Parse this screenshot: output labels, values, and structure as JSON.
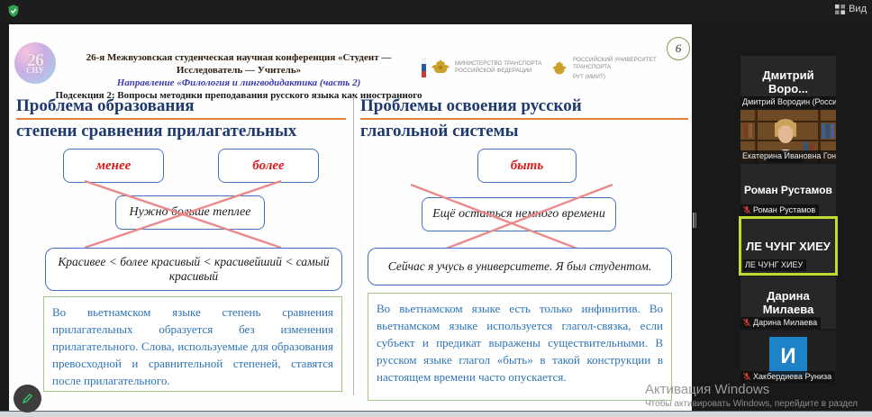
{
  "topbar": {
    "view_label": "Вид"
  },
  "slide": {
    "page_number": "6",
    "siu_logo": {
      "number": "26",
      "acronym": "СИУ"
    },
    "header": {
      "line1": "26-я Межвузовская студенческая научная конференция «Студент — Исследователь — Учитель»",
      "line2": "Направление «Филология и лингводидактика (часть 2)",
      "line3": "Подсекция 2: Вопросы методики преподавания русского языка как иностранного"
    },
    "ministry": {
      "line1": "МИНИСТЕРСТВО ТРАНСПОРТА",
      "line2": "РОССИЙСКОЙ ФЕДЕРАЦИИ"
    },
    "university": {
      "line1": "РОССИЙСКИЙ УНИВЕРСИТЕТ",
      "line2": "ТРАНСПОРТА",
      "line3": "РУТ (МИИТ)"
    },
    "left": {
      "title_line1": "Проблема образования",
      "title_line2": "степени сравнения прилагательных",
      "chip_less": "менее",
      "chip_more": "более",
      "crossed_example": "Нужно больше теплее",
      "comparison_example": "Красивее < более красивый < красивейший < самый красивый",
      "note": "Во вьетнамском языке степень сравнения прилагательных образуется без изменения прилагательного. Слова, используемые для образования превосходной и сравнительной степеней, ставятся после прилагательного."
    },
    "right": {
      "title_line1": "Проблемы освоения  русской",
      "title_line2": "глагольной системы",
      "chip_byt": "быть",
      "crossed_example": "Ещё остаться немного времени",
      "correct_example": "Сейчас я учусь в университете. Я был студентом.",
      "note": "Во вьетнамском языке есть только инфинитив. Во вьетнамском языке используется глагол-связка, если субъект и предикат выражены существительными. В русском языке глагол «быть» в такой конструкции в настоящем времени часто опускается."
    }
  },
  "participants": [
    {
      "name_display": "Дмитрий Воро...",
      "label": "Дмитрий Вородин (Росси...",
      "muted": false
    },
    {
      "name_display": "",
      "label": "Екатерина Ивановна Гон...",
      "muted": false
    },
    {
      "name_display": "Роман Рустамов",
      "label": "Роман Рустамов",
      "muted": true
    },
    {
      "name_display": "ЛЕ ЧУНГ ХИЕУ",
      "label": "ЛЕ ЧУНГ ХИЕУ",
      "muted": false,
      "active_speaker": true
    },
    {
      "name_display": "Дарина Милаева",
      "label": "Дарина Милаева",
      "muted": true
    },
    {
      "avatar_letter": "И",
      "label": "Хакбердиева Руниза",
      "muted": true
    }
  ],
  "watermark": {
    "line1": "Активация Windows",
    "line2": "Чтобы активировать Windows, перейдите в раздел"
  },
  "colors": {
    "accent_red": "#e01b1b",
    "title_blue": "#1e3a6e",
    "underline_orange": "#e8823c",
    "box_border_blue": "#4472c4",
    "note_green_border": "#a3c585",
    "note_text_blue": "#2e74b5",
    "active_speaker_border": "#c3d935",
    "avatar_blue": "#1e82c8",
    "muted_red": "#d03a3a"
  }
}
